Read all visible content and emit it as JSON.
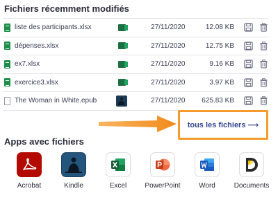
{
  "recent_section": {
    "title": "Fichiers récemment modifiés",
    "files": [
      {
        "name": "liste des participants.xlsx",
        "app_icon": "excel-icon",
        "date": "27/11/2020",
        "size": "12.08 KB",
        "type": "xlsx"
      },
      {
        "name": "dépenses.xlsx",
        "app_icon": "excel-icon",
        "date": "27/11/2020",
        "size": "12.75 KB",
        "type": "xlsx"
      },
      {
        "name": "ex7.xlsx",
        "app_icon": "excel-icon",
        "date": "27/11/2020",
        "size": "9.16 KB",
        "type": "xlsx"
      },
      {
        "name": "exercice3.xlsx",
        "app_icon": "excel-icon",
        "date": "27/11/2020",
        "size": "3.97 KB",
        "type": "xlsx"
      },
      {
        "name": "The Woman in White.epub",
        "app_icon": "kindle-icon",
        "date": "27/11/2020",
        "size": "625.83 KB",
        "type": "epub"
      }
    ],
    "all_files_link": "tous les fichiers ⟶"
  },
  "apps_section": {
    "title": "Apps avec fichiers",
    "apps": [
      {
        "label": "Acrobat",
        "icon": "acrobat-icon"
      },
      {
        "label": "Kindle",
        "icon": "kindle-icon"
      },
      {
        "label": "Excel",
        "icon": "excel-icon"
      },
      {
        "label": "PowerPoint",
        "icon": "powerpoint-icon"
      },
      {
        "label": "Word",
        "icon": "word-icon"
      },
      {
        "label": "Documents",
        "icon": "documents-icon"
      }
    ]
  },
  "colors": {
    "highlight": "#f59a2b",
    "link": "#33458f",
    "excel_green": "#1d6f42"
  }
}
